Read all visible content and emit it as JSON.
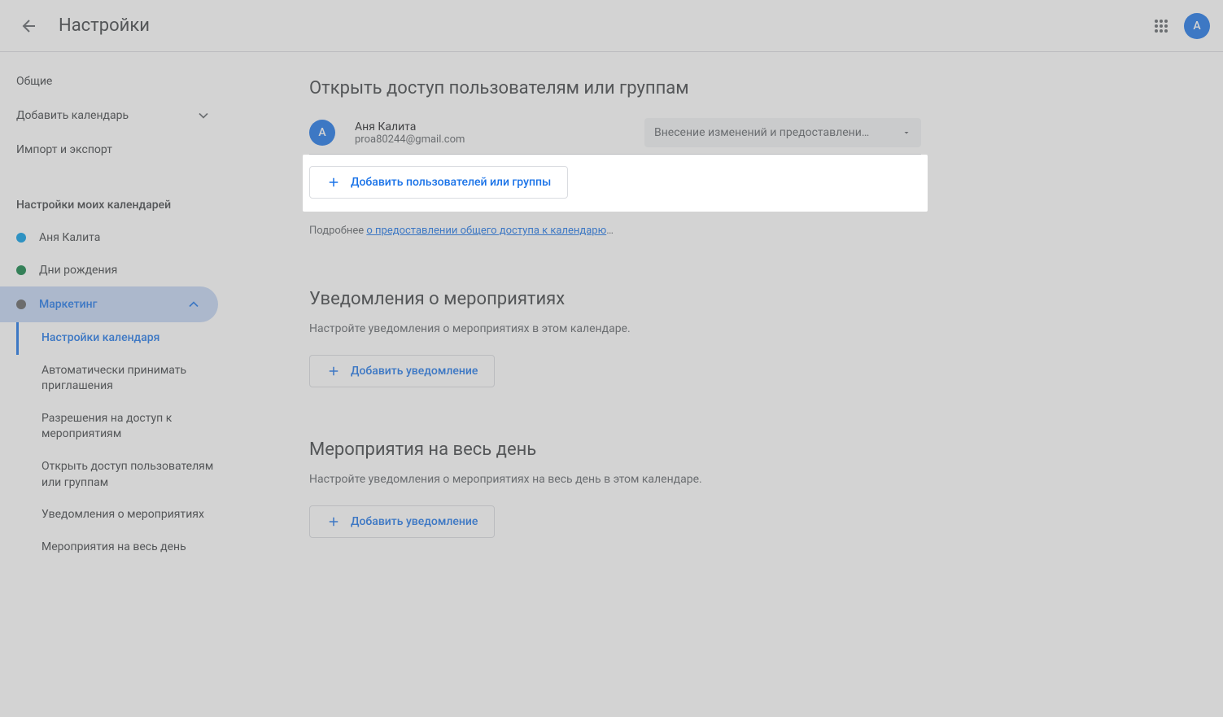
{
  "header": {
    "title": "Настройки",
    "avatar_letter": "А"
  },
  "sidebar": {
    "general": "Общие",
    "add_calendar": "Добавить календарь",
    "import_export": "Импорт и экспорт",
    "my_calendars_label": "Настройки моих календарей",
    "calendars": [
      {
        "label": "Аня Калита",
        "color": "#039be5"
      },
      {
        "label": "Дни рождения",
        "color": "#0b8043"
      },
      {
        "label": "Маркетинг",
        "color": "#616161"
      }
    ],
    "subnav": [
      "Настройки календаря",
      "Автоматически принимать приглашения",
      "Разрешения на доступ к мероприятиям",
      "Открыть доступ пользователям или группам",
      "Уведомления о мероприятиях",
      "Мероприятия на весь день"
    ]
  },
  "main": {
    "share": {
      "title": "Открыть доступ пользователям или группам",
      "user": {
        "avatar_letter": "А",
        "name": "Аня Калита",
        "email": "proa80244@gmail.com"
      },
      "permission": "Внесение изменений и предоставлени…",
      "add_button": "Добавить пользователей или группы",
      "more_info_prefix": "Подробнее ",
      "more_info_link": "о предоставлении общего доступа к календарю",
      "more_info_suffix": "…"
    },
    "event_notifications": {
      "title": "Уведомления о мероприятиях",
      "desc": "Настройте уведомления о мероприятиях в этом календаре.",
      "add_button": "Добавить уведомление"
    },
    "allday_notifications": {
      "title": "Мероприятия на весь день",
      "desc": "Настройте уведомления о мероприятиях на весь день в этом календаре.",
      "add_button": "Добавить уведомление"
    }
  }
}
